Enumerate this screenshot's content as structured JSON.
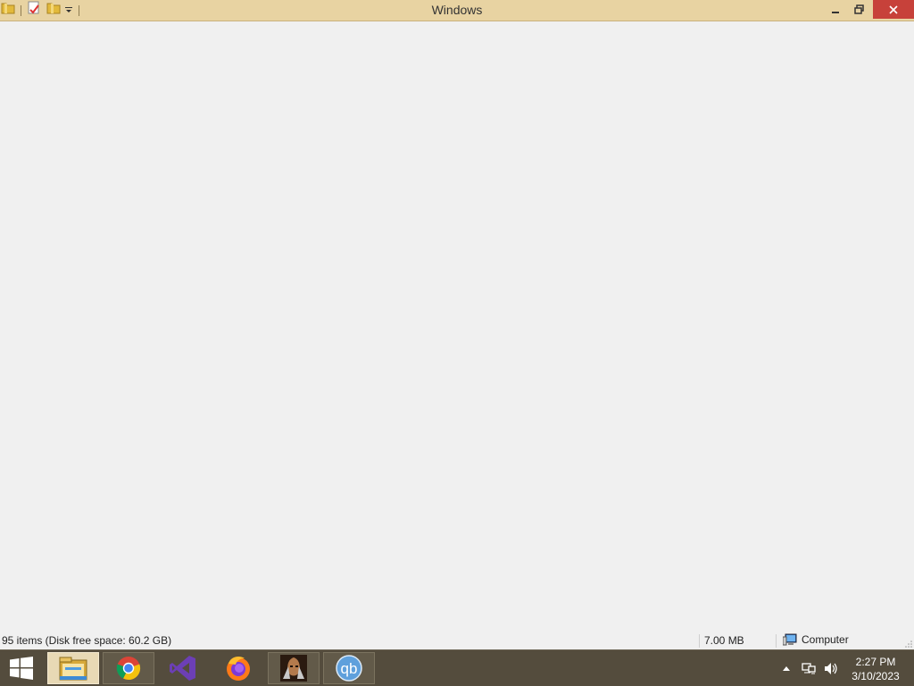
{
  "window": {
    "title": "Windows",
    "quick_access_icons": [
      "folder-icon",
      "properties-icon",
      "new-folder-icon",
      "customize-dropdown-icon"
    ],
    "controls": [
      "minimize-icon",
      "restore-icon",
      "close-icon"
    ]
  },
  "status_bar": {
    "items_text": "95 items (Disk free space: 60.2 GB)",
    "size_text": "7.00 MB",
    "zone_label": "Computer"
  },
  "taskbar": {
    "apps": [
      {
        "name": "File Explorer",
        "icon": "file-explorer-icon",
        "active": true
      },
      {
        "name": "Google Chrome",
        "icon": "chrome-icon"
      },
      {
        "name": "Visual Studio",
        "icon": "visual-studio-icon"
      },
      {
        "name": "Firefox",
        "icon": "firefox-icon"
      },
      {
        "name": "Game",
        "icon": "game-icon"
      },
      {
        "name": "qBittorrent",
        "icon": "qbittorrent-icon",
        "label": "qb"
      }
    ],
    "tray": {
      "time": "2:27 PM",
      "date": "3/10/2023"
    }
  },
  "colors": {
    "titlebar": "#e8d3a2",
    "taskbar": "#544c3d",
    "close_button": "#c7413a",
    "content_bg": "#f0f0f0"
  }
}
